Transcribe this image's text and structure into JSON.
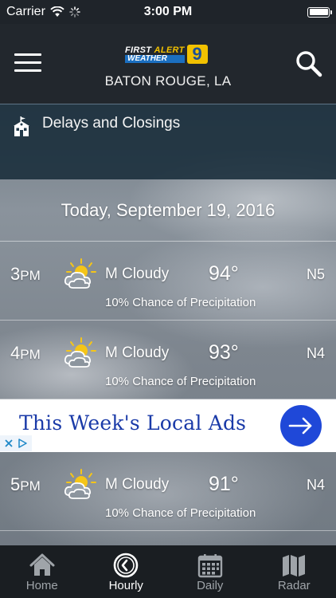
{
  "status_bar": {
    "carrier": "Carrier",
    "time": "3:00 PM",
    "battery_percent": 100
  },
  "header": {
    "logo": {
      "first": "FIRST",
      "alert": "ALERT",
      "weather": "WEATHER",
      "channel": "9"
    },
    "city": "BATON ROUGE, LA",
    "menu_icon": "hamburger-menu-icon",
    "search_icon": "search-icon"
  },
  "delays": {
    "icon": "schoolhouse-icon",
    "label": "Delays and Closings"
  },
  "date_label": "Today, September 19, 2016",
  "hourly": [
    {
      "hour": "3",
      "suffix": "PM",
      "icon": "partly-cloudy-icon",
      "condition": "M Cloudy",
      "temp": "94°",
      "wind": "N5",
      "precip": "10% Chance of Precipitation"
    },
    {
      "hour": "4",
      "suffix": "PM",
      "icon": "partly-cloudy-icon",
      "condition": "M Cloudy",
      "temp": "93°",
      "wind": "N4",
      "precip": "10% Chance of Precipitation"
    },
    {
      "hour": "5",
      "suffix": "PM",
      "icon": "partly-cloudy-icon",
      "condition": "M Cloudy",
      "temp": "91°",
      "wind": "N4",
      "precip": "10% Chance of Precipitation"
    }
  ],
  "ad": {
    "text": "This Week's Local Ads",
    "button_icon": "arrow-right-icon",
    "accent": "#1f48d8"
  },
  "tabs": [
    {
      "label": "Home",
      "icon": "home-icon",
      "active": false
    },
    {
      "label": "Hourly",
      "icon": "clock-icon",
      "active": true
    },
    {
      "label": "Daily",
      "icon": "calendar-icon",
      "active": false
    },
    {
      "label": "Radar",
      "icon": "map-icon",
      "active": false
    }
  ]
}
